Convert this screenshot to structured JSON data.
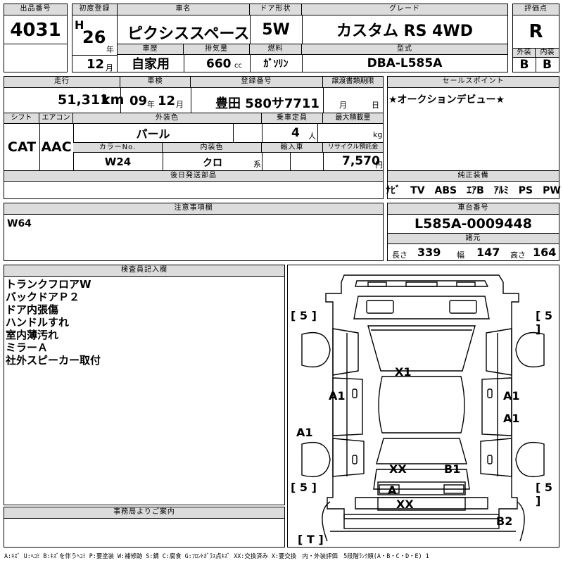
{
  "lot": {
    "label": "出品番号",
    "value": "4031"
  },
  "first_reg": {
    "label": "初度登録",
    "era": "H",
    "year": "26",
    "year_unit": "年",
    "month": "12",
    "month_unit": "月"
  },
  "car_name": {
    "label": "車名",
    "value": "ピクシススペース"
  },
  "door": {
    "label": "ドア形状",
    "value": "5W"
  },
  "grade": {
    "label": "グレード",
    "value": "カスタム RS 4WD"
  },
  "score": {
    "label": "評価点",
    "value": "R"
  },
  "history": {
    "label": "車歴",
    "value": "自家用"
  },
  "displacement": {
    "label": "排気量",
    "value": "660",
    "unit": "cc"
  },
  "fuel": {
    "label": "燃料",
    "value": "ｶﾞｿﾘﾝ"
  },
  "model_code": {
    "label": "型式",
    "value": "DBA-L585A"
  },
  "exterior_grade": {
    "label": "外装",
    "value": "B"
  },
  "interior_grade": {
    "label": "内装",
    "value": "B"
  },
  "mileage": {
    "label": "走行",
    "value": "51,311",
    "unit": "km"
  },
  "inspection": {
    "label": "車検",
    "year": "09",
    "year_unit": "年",
    "month": "12",
    "month_unit": "月"
  },
  "plate": {
    "label": "登録番号",
    "value": "豊田 580サ7711"
  },
  "transfer_deadline": {
    "label": "譲渡書類期限",
    "month_unit": "月",
    "day_unit": "日"
  },
  "sales_point": {
    "label": "セールスポイント",
    "value": "★オークションデビュー★"
  },
  "shift": {
    "label": "シフト",
    "value": "CAT"
  },
  "aircon": {
    "label": "エアコン",
    "value": "AAC"
  },
  "exterior_color": {
    "label": "外装色",
    "value": "パール"
  },
  "capacity": {
    "label": "乗車定員",
    "value": "4",
    "unit": "人"
  },
  "max_load": {
    "label": "最大積載量",
    "unit": "kg"
  },
  "color_no": {
    "label": "カラーNo.",
    "value": "W24"
  },
  "interior_color": {
    "label": "内装色",
    "value": "クロ",
    "unit": "系"
  },
  "import": {
    "label": "輸入車"
  },
  "recycle": {
    "label": "リサイクル預託金",
    "value": "7,570",
    "unit": "円"
  },
  "later_parts": {
    "label": "後日発送部品"
  },
  "equipment": {
    "label": "純正装備",
    "value": "ﾅﾋﾞ　TV　ABS　ｴｱB　ｱﾙﾐ　PS　PW"
  },
  "notes": {
    "label": "注意事項欄",
    "value": "W64"
  },
  "chassis": {
    "label": "車台番号",
    "value": "L585A-0009448"
  },
  "dimensions": {
    "label": "諸元",
    "length_label": "長さ",
    "length": "339",
    "width_label": "幅",
    "width": "147",
    "height_label": "高さ",
    "height": "164"
  },
  "inspector": {
    "label": "検査員記入欄",
    "lines": [
      "トランクフロアW",
      "バックドアＰ２",
      "ドア内張傷",
      "ハンドルすれ",
      "室内薄汚れ",
      "ミラーＡ",
      "社外スピーカー取付"
    ]
  },
  "office": {
    "label": "事務局よりご案内"
  },
  "damage": {
    "c1": "[ 5 ]",
    "c2": "[ 5 ]",
    "c3": "[ 5 ]",
    "c4": "[ 5 ]",
    "t": "[ T ]",
    "m1": "X1",
    "m2": "A1",
    "m3": "A1",
    "m4": "A1",
    "m5": "A1",
    "m6": "XX",
    "m7": "B1",
    "m8": "A",
    "m9": "XX",
    "m10": "B2"
  },
  "legend": "A:ｷｽﾞ U:ﾍｺﾐ B:ｷｽﾞを伴うﾍｺﾐ P:要塗装 W:補修跡 S:錆 C:腐食 G:ﾌﾛﾝﾄｶﾞﾗｽ点ｷｽﾞ XX:交換済み X:要交換　内・外装評価　5段階ﾗﾝｸ順(A・B・C・D・E) 1"
}
